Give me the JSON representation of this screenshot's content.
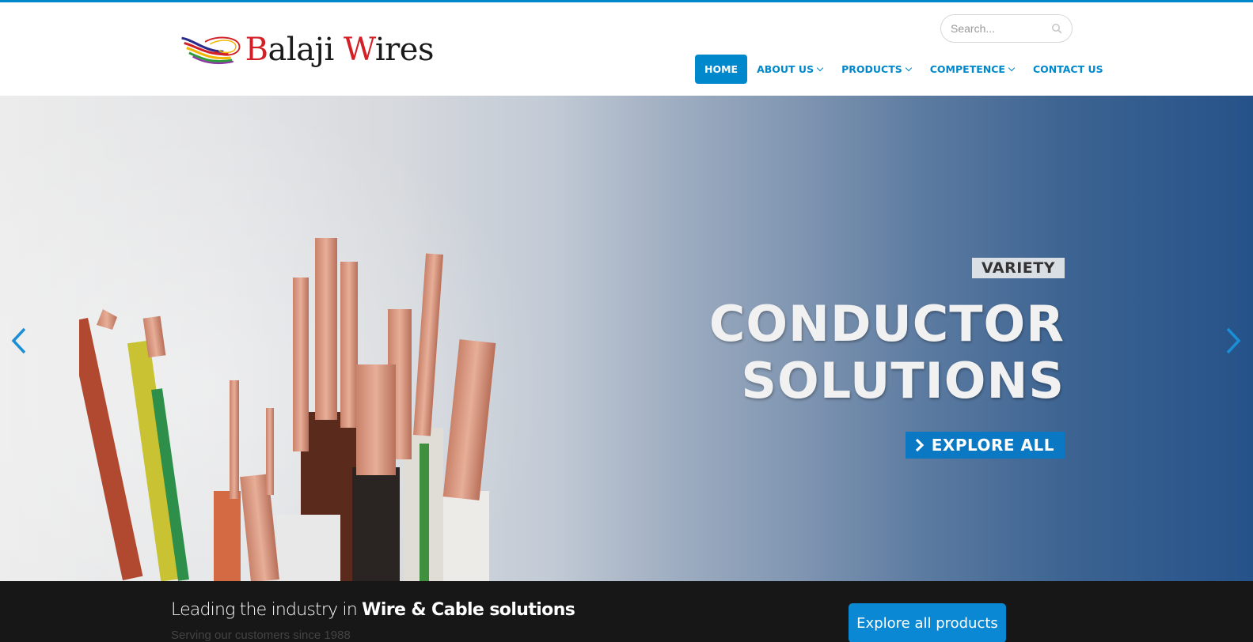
{
  "brand": {
    "logo_text_b": "B",
    "logo_text_rest1": "alaji ",
    "logo_text_w": "W",
    "logo_text_rest2": "ires",
    "accent_color": "#0088cc",
    "logo_red": "#d32027"
  },
  "search": {
    "placeholder": "Search...",
    "icon": "search-icon"
  },
  "nav": {
    "items": [
      {
        "label": "HOME",
        "active": true,
        "has_dropdown": false
      },
      {
        "label": "ABOUT US",
        "active": false,
        "has_dropdown": true
      },
      {
        "label": "PRODUCTS",
        "active": false,
        "has_dropdown": true
      },
      {
        "label": "COMPETENCE",
        "active": false,
        "has_dropdown": true
      },
      {
        "label": "CONTACT US",
        "active": false,
        "has_dropdown": false
      }
    ]
  },
  "hero": {
    "tag": "VARIETY",
    "headline_line1": "CONDUCTOR",
    "headline_line2": "SOLUTIONS",
    "button_label": "EXPLORE ALL",
    "button_icon": "chevron-right-icon",
    "prev_icon": "chevron-left-icon",
    "next_icon": "chevron-right-icon"
  },
  "cta": {
    "title_light": "Leading the industry in ",
    "title_strong": "Wire & Cable solutions",
    "subtitle": "Serving our customers since 1988",
    "button_label": "Explore all products",
    "button_color": "#0a88d4"
  }
}
